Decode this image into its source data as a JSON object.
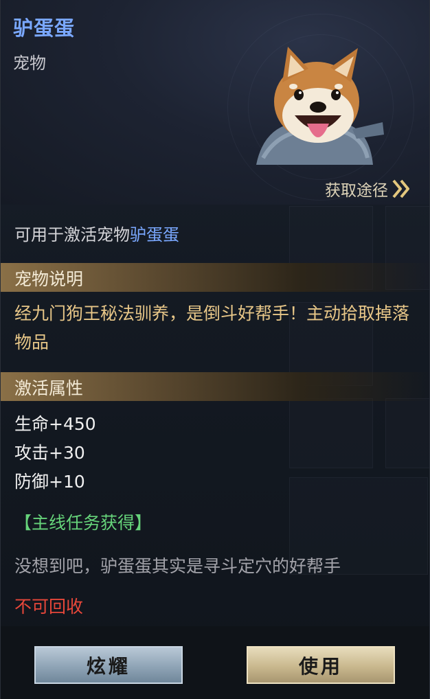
{
  "item": {
    "name": "驴蛋蛋",
    "type": "宠物",
    "acquire_label": "获取途径"
  },
  "usage": {
    "prefix": "可用于激活宠物",
    "highlight": "驴蛋蛋"
  },
  "pet_description": {
    "title": "宠物说明",
    "text": "经九门狗王秘法驯养，是倒斗好帮手！主动拾取掉落物品"
  },
  "activation": {
    "title": "激活属性",
    "attrs": [
      "生命+450",
      "攻击+30",
      "防御+10"
    ]
  },
  "source": "【主线任务获得】",
  "flavor_text": "没想到吧，驴蛋蛋其实是寻斗定穴的好帮手",
  "recycle_note": "不可回收",
  "buttons": {
    "show_off": "炫耀",
    "use": "使用"
  },
  "colors": {
    "name": "#7aa8ff",
    "description": "#e8c788",
    "source": "#66d37a",
    "warning": "#e8473a"
  },
  "icons": {
    "acquire": "double-chevron-right-icon",
    "portrait": "shiba-dog-portrait"
  }
}
